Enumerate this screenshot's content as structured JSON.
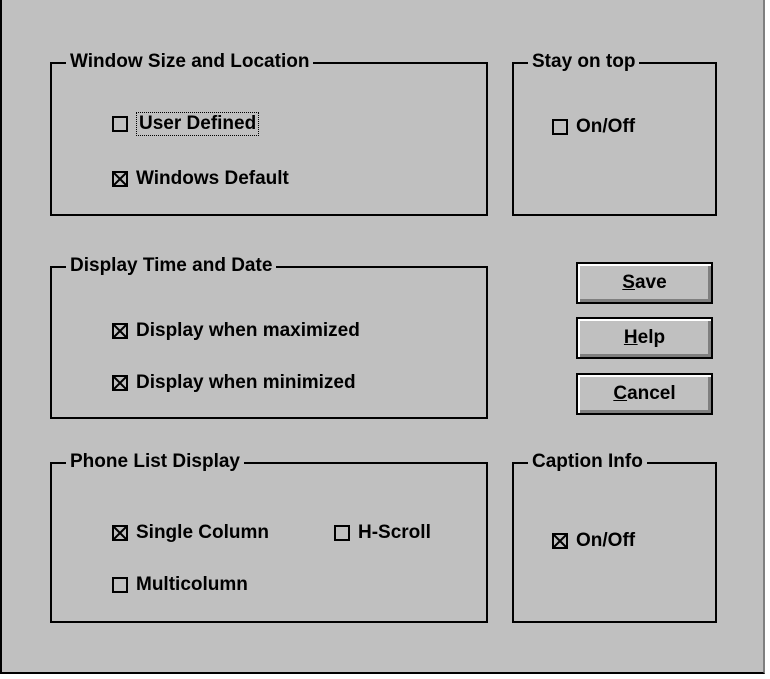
{
  "groups": {
    "window": {
      "title": "Window Size and Location",
      "user_defined": "User Defined",
      "windows_default": "Windows Default",
      "user_defined_checked": false,
      "windows_default_checked": true
    },
    "stay_on_top": {
      "title": "Stay on top",
      "on_off": "On/Off",
      "checked": false
    },
    "display": {
      "title": "Display Time and Date",
      "when_maximized": "Display when maximized",
      "when_minimized": "Display when minimized",
      "maximized_checked": true,
      "minimized_checked": true
    },
    "phone_list": {
      "title": "Phone List Display",
      "single_column": "Single Column",
      "h_scroll": "H-Scroll",
      "multicolumn": "Multicolumn",
      "single_column_checked": true,
      "h_scroll_checked": false,
      "multicolumn_checked": false
    },
    "caption": {
      "title": "Caption Info",
      "on_off": "On/Off",
      "checked": true
    }
  },
  "buttons": {
    "save": {
      "mnemonic": "S",
      "rest": "ave"
    },
    "help": {
      "mnemonic": "H",
      "rest": "elp"
    },
    "cancel": {
      "mnemonic": "C",
      "rest": "ancel"
    }
  }
}
